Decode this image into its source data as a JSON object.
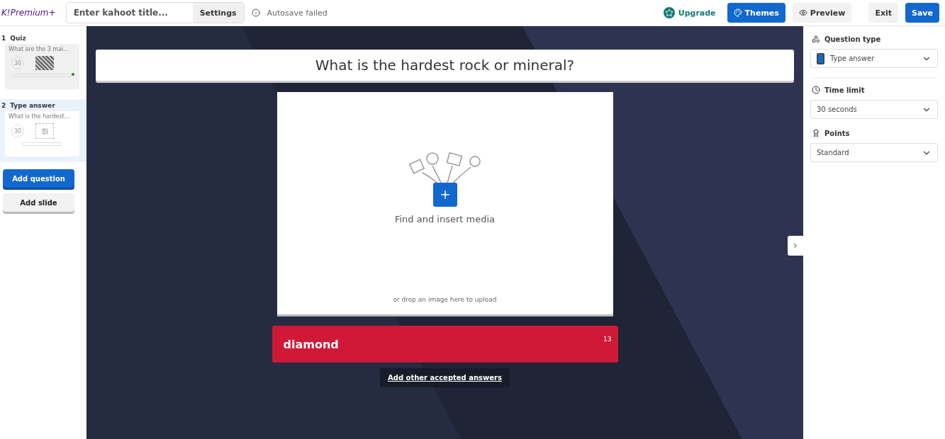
{
  "topbar": {
    "logo": "K!",
    "plan": "Premium+",
    "title_field": {
      "placeholder": "Enter kahoot title..."
    },
    "settings": "Settings",
    "autosave": "Autosave failed",
    "upgrade": "Upgrade",
    "buttons": [
      {
        "label": "Themes",
        "kind": "primary"
      },
      {
        "label": "Preview",
        "kind": "secondary"
      },
      {
        "label": "Exit",
        "kind": "plain"
      },
      {
        "label": "Save",
        "kind": "primary"
      }
    ]
  },
  "slides": [
    {
      "number": "1",
      "type": "Quiz",
      "preview": "What are the 3 mai...",
      "timer": "30",
      "kind": "quiz",
      "selected": false
    },
    {
      "number": "2",
      "type": "Type answer",
      "preview": "What is the hardest...",
      "timer": "30",
      "kind": "typeanswer",
      "selected": true
    }
  ],
  "sidebar_buttons": [
    {
      "label": "Add question",
      "kind": "primary"
    },
    {
      "label": "Add slide",
      "kind": "secondary"
    }
  ],
  "question": "What is the hardest rock or mineral?",
  "media": {
    "label": "Find and insert media",
    "hint": "or drop an image here to upload"
  },
  "answer": {
    "value": "diamond",
    "remaining": "13"
  },
  "add_answers": "Add other accepted answers",
  "settings_panel": [
    {
      "label": "Question type",
      "value": "Type answer"
    },
    {
      "label": "Time limit",
      "value": "30 seconds"
    },
    {
      "label": "Points",
      "value": "Standard"
    }
  ]
}
